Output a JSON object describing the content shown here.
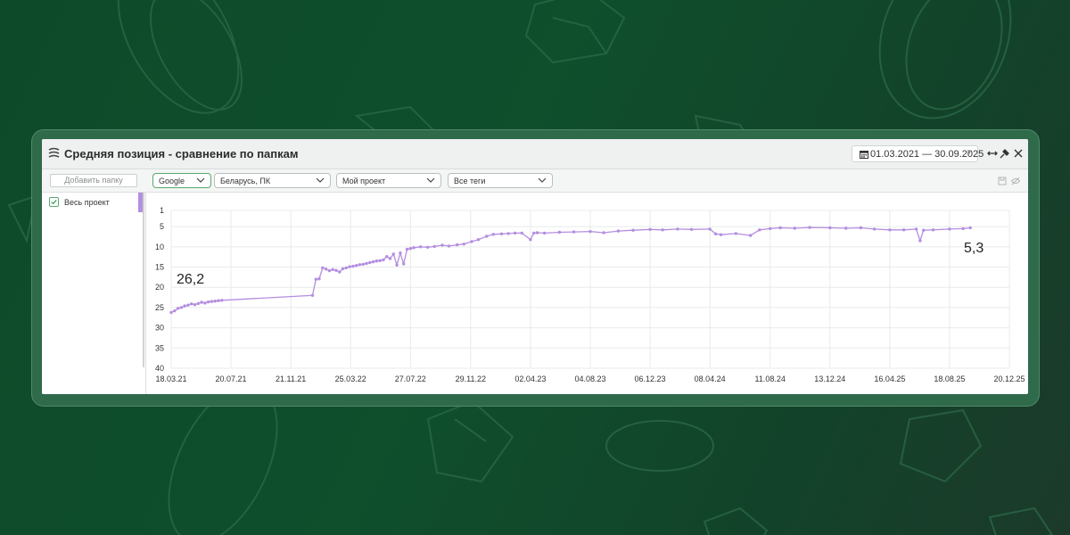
{
  "window": {
    "title": "Средняя позиция - сравнение по папкам",
    "date_range": "01.03.2021 — 30.09.2025"
  },
  "filters": {
    "add_folder": "Добавить папку",
    "search_engine": "Google",
    "region": "Беларусь, ПК",
    "project": "Мой проект",
    "tags": "Все теги"
  },
  "sidebar": {
    "items": [
      {
        "label": "Весь проект",
        "checked": true,
        "color": "#b48ee0"
      }
    ]
  },
  "annotations": {
    "start": "26,2",
    "end": "5,3"
  },
  "colors": {
    "line": "#b48ee0",
    "accent": "#5aa86f"
  },
  "chart_data": {
    "type": "line",
    "x_ticks": [
      "18.03.21",
      "20.07.21",
      "21.11.21",
      "25.03.22",
      "27.07.22",
      "29.11.22",
      "02.04.23",
      "04.08.23",
      "06.12.23",
      "08.04.24",
      "11.08.24",
      "13.12.24",
      "16.04.25",
      "18.08.25",
      "20.12.25"
    ],
    "y_ticks": [
      1,
      5,
      10,
      15,
      20,
      25,
      30,
      35,
      40
    ],
    "ylim": [
      1,
      40
    ],
    "y_inverted": true,
    "grid": true,
    "series": [
      {
        "x": [
          "2021-03-18",
          "2021-03-25",
          "2021-04-01",
          "2021-04-08",
          "2021-04-15",
          "2021-04-22",
          "2021-04-29",
          "2021-05-06",
          "2021-05-13",
          "2021-05-20",
          "2021-05-27",
          "2021-06-03",
          "2021-06-10",
          "2021-06-17",
          "2021-06-24",
          "2021-07-01",
          "2022-01-05",
          "2022-01-12",
          "2022-01-19",
          "2022-01-26",
          "2022-02-02",
          "2022-02-09",
          "2022-02-16",
          "2022-02-23",
          "2022-03-02",
          "2022-03-09",
          "2022-03-16",
          "2022-03-23",
          "2022-03-30",
          "2022-04-06",
          "2022-04-13",
          "2022-04-20",
          "2022-04-27",
          "2022-05-04",
          "2022-05-11",
          "2022-05-18",
          "2022-05-25",
          "2022-06-01",
          "2022-06-08",
          "2022-06-15",
          "2022-06-22",
          "2022-06-29",
          "2022-07-06",
          "2022-07-13",
          "2022-07-20",
          "2022-07-27",
          "2022-08-03",
          "2022-08-17",
          "2022-09-01",
          "2022-09-15",
          "2022-10-01",
          "2022-10-15",
          "2022-11-01",
          "2022-11-15",
          "2022-12-01",
          "2022-12-15",
          "2023-01-01",
          "2023-01-15",
          "2023-02-01",
          "2023-02-15",
          "2023-03-01",
          "2023-03-15",
          "2023-04-02",
          "2023-04-09",
          "2023-04-16",
          "2023-05-01",
          "2023-06-01",
          "2023-07-01",
          "2023-08-04",
          "2023-09-01",
          "2023-10-01",
          "2023-11-01",
          "2023-12-06",
          "2024-01-01",
          "2024-02-01",
          "2024-03-01",
          "2024-04-08",
          "2024-04-20",
          "2024-05-01",
          "2024-06-01",
          "2024-07-01",
          "2024-07-20",
          "2024-08-11",
          "2024-09-01",
          "2024-10-01",
          "2024-11-01",
          "2024-12-13",
          "2025-01-15",
          "2025-02-15",
          "2025-03-15",
          "2025-04-16",
          "2025-05-15",
          "2025-06-10",
          "2025-06-18",
          "2025-06-25",
          "2025-07-15",
          "2025-08-18",
          "2025-09-15",
          "2025-09-30"
        ],
        "y": [
          26.2,
          25.8,
          25.2,
          25.0,
          24.6,
          24.4,
          24.1,
          24.3,
          24.0,
          23.7,
          23.9,
          23.6,
          23.5,
          23.4,
          23.3,
          23.2,
          22.0,
          18.0,
          17.9,
          15.2,
          15.5,
          15.9,
          15.6,
          15.8,
          16.2,
          15.4,
          15.2,
          14.9,
          14.8,
          14.6,
          14.4,
          14.3,
          14.1,
          13.9,
          13.7,
          13.5,
          13.4,
          13.2,
          12.4,
          12.9,
          11.8,
          14.5,
          11.5,
          14.2,
          10.6,
          10.4,
          10.2,
          10.0,
          10.1,
          9.9,
          9.6,
          9.8,
          9.5,
          9.3,
          8.7,
          8.2,
          7.4,
          6.9,
          6.8,
          6.7,
          6.6,
          6.6,
          8.2,
          6.6,
          6.5,
          6.6,
          6.4,
          6.3,
          6.2,
          6.5,
          6.1,
          5.9,
          5.7,
          5.8,
          5.6,
          5.7,
          5.6,
          6.8,
          7.0,
          6.7,
          7.2,
          5.8,
          5.5,
          5.3,
          5.4,
          5.2,
          5.3,
          5.4,
          5.3,
          5.6,
          5.8,
          5.8,
          5.6,
          8.5,
          5.9,
          5.8,
          5.6,
          5.5,
          5.3
        ]
      }
    ]
  }
}
